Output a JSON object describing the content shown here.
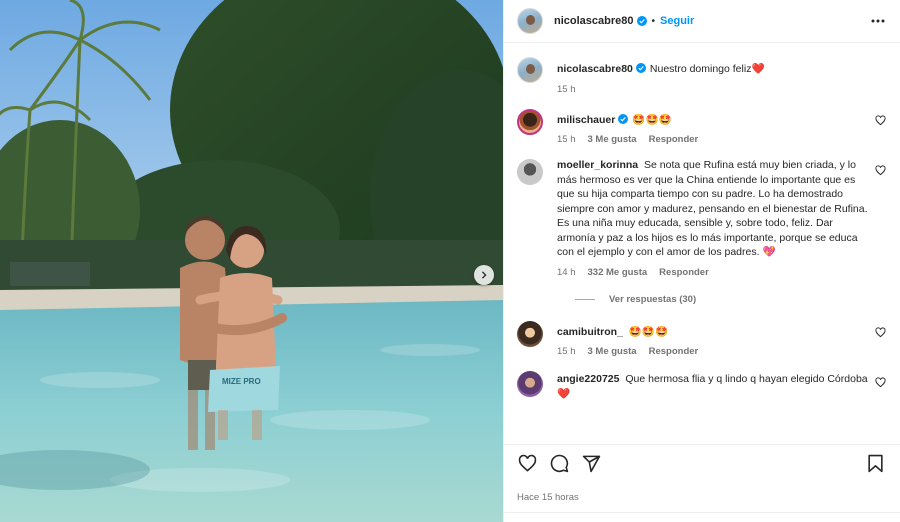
{
  "post": {
    "author": "nicolascabre80",
    "follow_label": "Seguir",
    "separator": "•"
  },
  "caption": {
    "username": "nicolascabre80",
    "text": "Nuestro domingo feliz",
    "emoji": "❤️",
    "time": "15 h"
  },
  "comments": [
    {
      "username": "milischauer",
      "text": "🤩🤩🤩",
      "time": "15 h",
      "likes": "3 Me gusta",
      "reply": "Responder",
      "verified": true
    },
    {
      "username": "moeller_korinna",
      "text": "Se nota que Rufina está muy bien criada, y lo más hermoso es ver que la China entiende lo importante que es que su hija comparta tiempo con su padre. Lo ha demostrado siempre con amor y madurez, pensando en el bienestar de Rufina. Es una niña muy educada, sensible y, sobre todo, feliz. Dar armonía y paz a los hijos es lo más importante, porque se educa con el ejemplo y con el amor de los padres. 💖",
      "time": "14 h",
      "likes": "332 Me gusta",
      "reply": "Responder",
      "replies_label": "Ver respuestas (30)"
    },
    {
      "username": "camibuitron_",
      "text": "🤩🤩🤩",
      "time": "15 h",
      "likes": "3 Me gusta",
      "reply": "Responder"
    },
    {
      "username": "angie220725",
      "text": "Que hermosa flia y q lindo q hayan elegido Córdoba ❤️"
    }
  ],
  "footer": {
    "time_label": "Hace 15 horas"
  },
  "icons": {
    "verified": "verified-badge-icon",
    "more": "more-options-icon",
    "like": "heart-icon",
    "comment": "comment-icon",
    "share": "share-icon",
    "save": "bookmark-icon",
    "next": "chevron-right-icon"
  },
  "colors": {
    "link_blue": "#0095f6",
    "verified_blue": "#0095f6",
    "secondary_text": "#737373"
  }
}
